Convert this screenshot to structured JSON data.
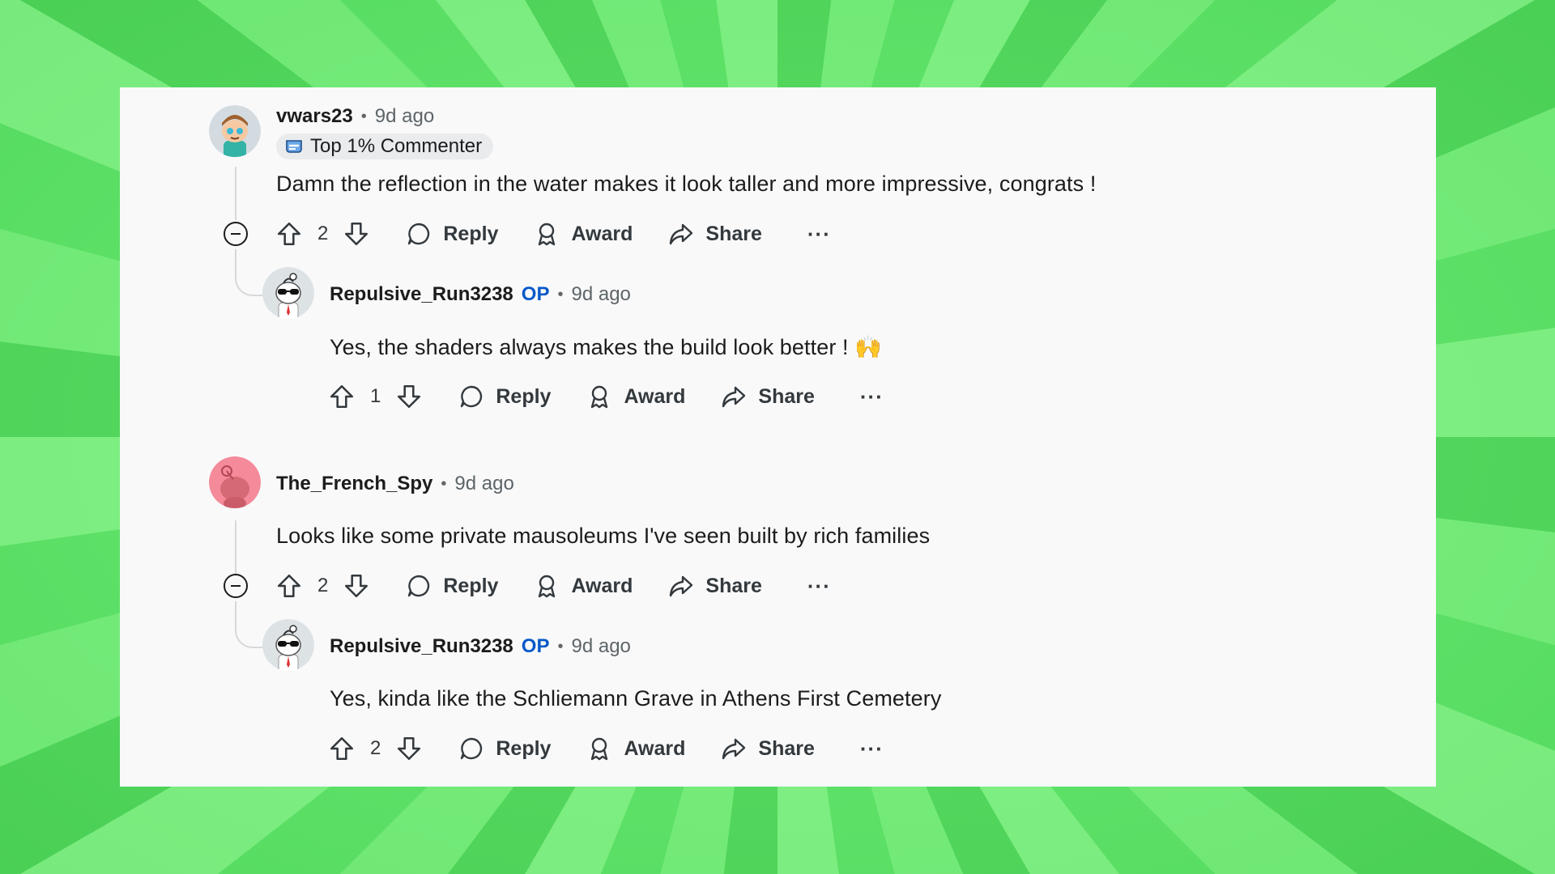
{
  "comments": [
    {
      "username": "vwars23",
      "time": "9d ago",
      "flair": "Top 1% Commenter",
      "body": "Damn the reflection in the water makes it look taller and more impressive, congrats !",
      "votes": "2",
      "reply_label": "Reply",
      "award_label": "Award",
      "share_label": "Share",
      "more_label": "···"
    },
    {
      "username": "Repulsive_Run3238",
      "op_badge": "OP",
      "time": "9d ago",
      "body": "Yes, the shaders always makes the build look better ! 🙌",
      "votes": "1",
      "reply_label": "Reply",
      "award_label": "Award",
      "share_label": "Share",
      "more_label": "···"
    },
    {
      "username": "The_French_Spy",
      "time": "9d ago",
      "body": "Looks like some private mausoleums I've seen built by rich families",
      "votes": "2",
      "reply_label": "Reply",
      "award_label": "Award",
      "share_label": "Share",
      "more_label": "···"
    },
    {
      "username": "Repulsive_Run3238",
      "op_badge": "OP",
      "time": "9d ago",
      "body": "Yes, kinda like the Schliemann Grave in Athens First Cemetery",
      "votes": "2",
      "reply_label": "Reply",
      "award_label": "Award",
      "share_label": "Share",
      "more_label": "···"
    }
  ],
  "separator": "•",
  "colors": {
    "op": "#0a59c9",
    "card_background": "#f9f9fa",
    "page_background": "#5ee169"
  }
}
